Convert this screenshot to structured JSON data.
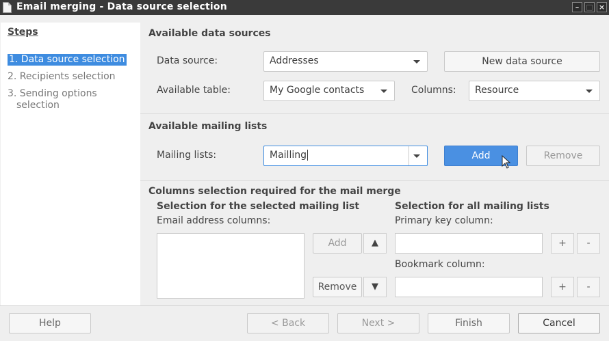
{
  "window": {
    "title": "Email merging - Data source selection",
    "controls": [
      "–",
      "□",
      "×"
    ]
  },
  "steps": {
    "title": "Steps",
    "items": [
      {
        "label": "1. Data source selection"
      },
      {
        "label": "2. Recipients selection"
      },
      {
        "label": "3. Sending options"
      },
      {
        "label": "selection"
      }
    ]
  },
  "data_sources": {
    "title": "Available data sources",
    "data_source_label": "Data source:",
    "data_source_value": "Addresses",
    "new_data_source_label": "New data source",
    "available_table_label": "Available table:",
    "available_table_value": "My Google contacts",
    "columns_label": "Columns:",
    "columns_value": "Resource"
  },
  "mailing_lists": {
    "title": "Available mailing lists",
    "label": "Mailing lists:",
    "value": "Mailling",
    "add_label": "Add",
    "remove_label": "Remove"
  },
  "columns_selection": {
    "title": "Columns selection required for the mail merge",
    "selected_title": "Selection for the selected mailing list",
    "all_title": "Selection for all mailing lists",
    "email_columns_label": "Email address columns:",
    "add_label": "Add",
    "remove_label": "Remove",
    "up_symbol": "▲",
    "down_symbol": "▼",
    "primary_key_label": "Primary key column:",
    "bookmark_label": "Bookmark column:",
    "plus": "+",
    "minus": "-"
  },
  "footer": {
    "help": "Help",
    "back": "< Back",
    "next": "Next >",
    "finish": "Finish",
    "cancel": "Cancel"
  }
}
